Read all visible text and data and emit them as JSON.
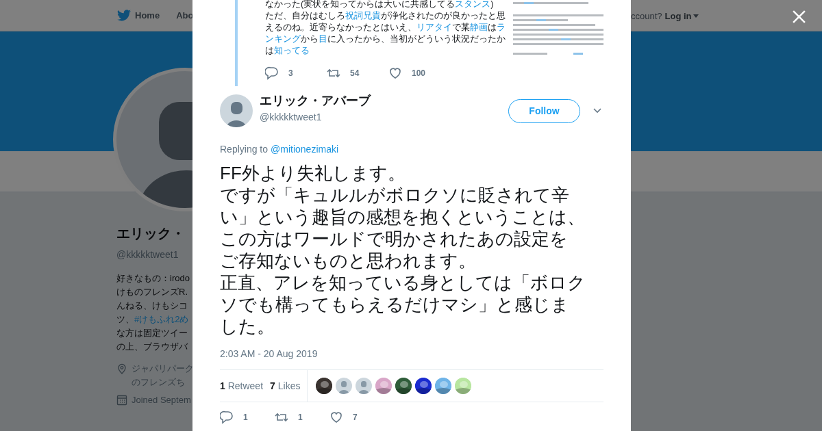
{
  "background": {
    "nav": [
      {
        "label": "Home",
        "kind": "home"
      },
      {
        "label": "Abo",
        "kind": "plain"
      }
    ],
    "account_prompt": "ccount?",
    "login": "Log in",
    "profile": {
      "name": "エリック・",
      "handle": "@kkkkktweet1",
      "bio_lines": [
        [
          {
            "text": "好きなもの：irodo",
            "link": false
          }
        ],
        [
          {
            "text": "けものフレンズR.",
            "link": false
          }
        ],
        [
          {
            "text": "んねる、けもシコ",
            "link": false
          }
        ],
        [
          {
            "text": "ツ、",
            "link": false
          },
          {
            "text": "#けもふれ2め",
            "link": true
          }
        ],
        [
          {
            "text": "な方は固定ツイー",
            "link": false
          }
        ],
        [
          {
            "text": "の上、ブラウザバ",
            "link": false
          }
        ]
      ],
      "location_lines": [
        "ジャパリパーク",
        "のフレンズち"
      ],
      "joined": "Joined Septem"
    }
  },
  "quoted_tweet": {
    "lines": [
      [
        {
          "text": "なかった(実状を知ってからは大いに共感してる",
          "link": false
        },
        {
          "text": "スタンス",
          "link": true
        },
        {
          "text": ")",
          "link": false
        }
      ],
      [
        {
          "text": "ただ、自分はむしろ",
          "link": false
        },
        {
          "text": "祝詞兄貴",
          "link": true
        },
        {
          "text": "が浄化されたのが良かったと思",
          "link": false
        }
      ],
      [
        {
          "text": "えるのね。近寄らなかったとはいえ、",
          "link": false
        },
        {
          "text": "リアタイ",
          "link": true
        },
        {
          "text": "で某",
          "link": false
        },
        {
          "text": "静画",
          "link": true
        },
        {
          "text": "は",
          "link": false
        },
        {
          "text": "ラ",
          "link": true
        }
      ],
      [
        {
          "text": "ンキング",
          "link": true
        },
        {
          "text": "から",
          "link": false
        },
        {
          "text": "目",
          "link": true
        },
        {
          "text": "に入ったから、当初がどういう状況だったか",
          "link": false
        }
      ],
      [
        {
          "text": "は",
          "link": false
        },
        {
          "text": "知ってる",
          "link": true
        }
      ]
    ],
    "attachment": {
      "kind": "picture"
    },
    "actions": [
      {
        "kind": "reply",
        "count": "3"
      },
      {
        "kind": "retweet",
        "count": "54"
      },
      {
        "kind": "like",
        "count": "100"
      }
    ]
  },
  "tweet": {
    "name": "エリック・アバーブ",
    "handle": "@kkkkktweet1",
    "follow": "Follow",
    "replying_to": "Replying to",
    "reply_handle": "@mitionezimaki",
    "text_lines": [
      "FF外より失礼します。",
      "ですが「キュルルがボロクソに貶されて辛",
      "い」という趣旨の感想を抱くということは、",
      "この方はワールドで明かされたあの設定を",
      "ご存知ないものと思われます。",
      "正直、アレを知っている身としては「ボロク",
      "ソでも構ってもらえるだけマシ」と感じま",
      "した。"
    ],
    "timestamp": "2:03 AM - 20 Aug 2019",
    "stats": [
      {
        "count": "1",
        "label": "Retweet"
      },
      {
        "count": "7",
        "label": "Likes"
      }
    ],
    "likers": [
      {
        "kind": "picture",
        "color": "#3a3330"
      },
      {
        "kind": "default",
        "color": "#ccd6dd"
      },
      {
        "kind": "default",
        "color": "#ccd6dd"
      },
      {
        "kind": "picture",
        "color": "#d9a6c8"
      },
      {
        "kind": "picture",
        "color": "#2f5d3a"
      },
      {
        "kind": "picture",
        "color": "#1a2bd0"
      },
      {
        "kind": "picture",
        "color": "#6fb4e8"
      },
      {
        "kind": "picture",
        "color": "#b8e6a0"
      }
    ],
    "actions": [
      {
        "kind": "reply",
        "count": "1"
      },
      {
        "kind": "retweet",
        "count": "1"
      },
      {
        "kind": "like",
        "count": "7"
      }
    ]
  }
}
